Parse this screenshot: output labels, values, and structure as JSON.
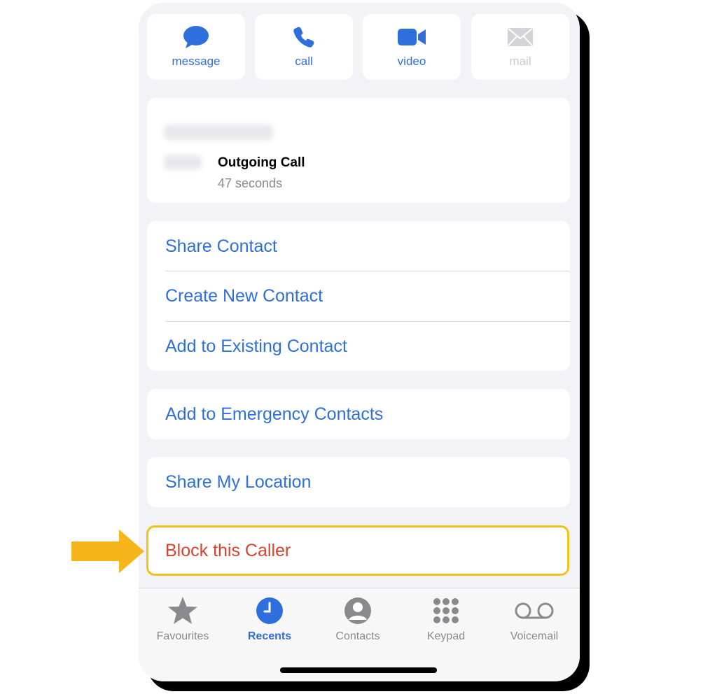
{
  "actions": [
    {
      "label": "message",
      "icon": "message-bubble-icon"
    },
    {
      "label": "call",
      "icon": "phone-icon"
    },
    {
      "label": "video",
      "icon": "video-camera-icon"
    },
    {
      "label": "mail",
      "icon": "mail-envelope-icon"
    }
  ],
  "call_info": {
    "type": "Outgoing Call",
    "duration": "47 seconds"
  },
  "contact_options": [
    "Share Contact",
    "Create New Contact",
    "Add to Existing Contact"
  ],
  "emergency": "Add to Emergency Contacts",
  "location": "Share My Location",
  "block": "Block this Caller",
  "tabs": [
    {
      "label": "Favourites",
      "icon": "star-icon"
    },
    {
      "label": "Recents",
      "icon": "clock-icon",
      "active": true
    },
    {
      "label": "Contacts",
      "icon": "person-circle-icon"
    },
    {
      "label": "Keypad",
      "icon": "keypad-icon"
    },
    {
      "label": "Voicemail",
      "icon": "voicemail-icon"
    }
  ],
  "colors": {
    "accent": "#2f6fdc",
    "destructive": "#d8432f",
    "highlight": "#f5c21b",
    "background": "#f2f2f7"
  }
}
